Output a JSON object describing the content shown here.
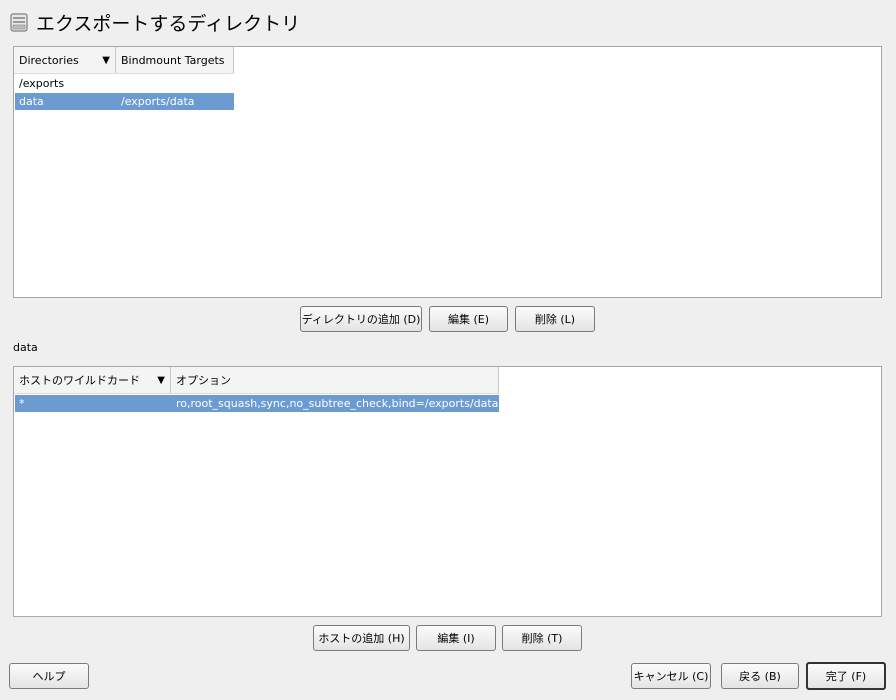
{
  "title": "エクスポートするディレクトリ",
  "directories_table": {
    "columns": [
      "Directories",
      "Bindmount Targets"
    ],
    "rows": [
      {
        "directory": "/exports",
        "target": ""
      },
      {
        "directory": "data",
        "target": "/exports/data",
        "selected": true
      }
    ]
  },
  "directory_buttons": {
    "add": "ディレクトリの追加 (D)",
    "edit": "編集 (E)",
    "delete": "削除 (L)"
  },
  "selected_directory_label": "data",
  "hosts_table": {
    "columns": [
      "ホストのワイルドカード",
      "オプション"
    ],
    "rows": [
      {
        "host": "*",
        "options": "ro,root_squash,sync,no_subtree_check,bind=/exports/data",
        "selected": true
      }
    ]
  },
  "host_buttons": {
    "add": "ホストの追加 (H)",
    "edit": "編集 (I)",
    "delete": "削除 (T)"
  },
  "footer": {
    "help": "ヘルプ",
    "cancel": "キャンセル (C)",
    "back": "戻る (B)",
    "finish": "完了 (F)"
  },
  "icons": {
    "title": "nfs-folder-icon",
    "sort": "chevron-down-icon"
  }
}
